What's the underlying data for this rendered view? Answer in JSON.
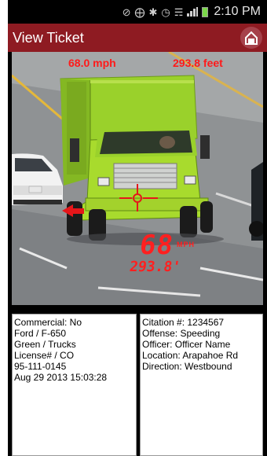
{
  "status_bar": {
    "time": "2:10 PM",
    "icons": [
      "no-disturb-icon",
      "gps-icon",
      "bluetooth-icon",
      "alarm-icon",
      "wifi-icon",
      "signal-icon",
      "battery-icon"
    ]
  },
  "header": {
    "title": "View Ticket",
    "home_icon": "home-icon"
  },
  "photo": {
    "speed_text": "68.0  mph",
    "distance_text": "293.8  feet",
    "lcd_speed": "68",
    "lcd_unit": "MPH",
    "lcd_distance": "293.8'"
  },
  "vehicle_panel": {
    "lines": [
      "Commercial: No",
      "Ford / F-650",
      "Green / Trucks",
      "License# / CO",
      "95-111-0145",
      "Aug 29 2013 15:03:28"
    ]
  },
  "citation_panel": {
    "lines": [
      "Citation #: 1234567",
      "Offense: Speeding",
      "Officer: Officer Name",
      "Location: Arapahoe Rd",
      "Direction: Westbound"
    ]
  },
  "colors": {
    "title_bar": "#8e1b22",
    "overlay_text": "#ff1a1a",
    "truck_body": "#9ad12b"
  }
}
